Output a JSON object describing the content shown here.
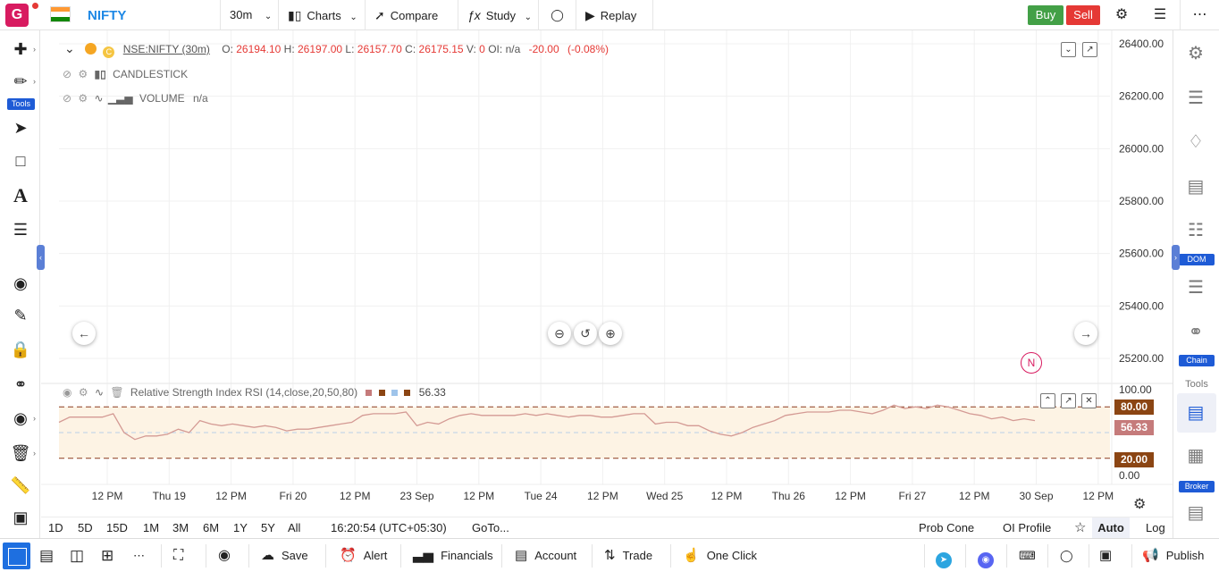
{
  "app": {
    "logo_letter": "G",
    "symbol": "NIFTY"
  },
  "toolbar": {
    "interval": "30m",
    "charts": "Charts",
    "compare": "Compare",
    "study": "Study",
    "replay": "Replay",
    "buy": "Buy",
    "sell": "Sell"
  },
  "left_toolbar": {
    "tools_badge": "Tools"
  },
  "legend": {
    "symbol_desc": "NSE:NIFTY (30m)",
    "o_label": "O:",
    "o": "26194.10",
    "h_label": "H:",
    "h": "26197.00",
    "l_label": "L:",
    "l": "26157.70",
    "c_label": "C:",
    "c": "26175.15",
    "v_label": "V:",
    "v": "0",
    "oi_label": "OI:",
    "oi": "n/a",
    "change": "-20.00",
    "change_pct": "(-0.08%)",
    "candlestick": "CANDLESTICK",
    "volume": "VOLUME",
    "volume_val": "n/a"
  },
  "rsi": {
    "title": "Relative Strength Index RSI (14,close,20,50,80)",
    "value": "56.33",
    "upper_tag": "80.00",
    "lower_tag": "20.00"
  },
  "n_badge": "N",
  "colors": {
    "rsi_line": "#d49a94",
    "rsi_band": "#fdf3e4",
    "rsi_dash": "#8b3a1f",
    "tag_brown": "#8b4513",
    "tag_rose": "#c57b7b",
    "accent_blue": "#1e5bd6"
  },
  "chart_data": {
    "type": "line",
    "price_axis": {
      "ticks": [
        "26400.00",
        "26200.00",
        "26000.00",
        "25800.00",
        "25600.00",
        "25400.00",
        "25200.00"
      ],
      "values": [
        26400,
        26200,
        26000,
        25800,
        25600,
        25400,
        25200
      ]
    },
    "rsi_axis": {
      "ticks": [
        "100.00",
        "0.00"
      ],
      "values": [
        100,
        0
      ],
      "upper": 80,
      "lower": 20,
      "ylim": [
        0,
        100
      ]
    },
    "time_axis": [
      "12 PM",
      "Thu 19",
      "12 PM",
      "Fri 20",
      "12 PM",
      "23 Sep",
      "12 PM",
      "Tue 24",
      "12 PM",
      "Wed 25",
      "12 PM",
      "Thu 26",
      "12 PM",
      "Fri 27",
      "12 PM",
      "30 Sep",
      "12 PM"
    ],
    "rsi_series": {
      "name": "RSI",
      "values": [
        62,
        68,
        68,
        68,
        68,
        72,
        50,
        42,
        46,
        46,
        48,
        54,
        50,
        64,
        60,
        58,
        60,
        58,
        56,
        58,
        56,
        52,
        54,
        54,
        56,
        58,
        60,
        62,
        70,
        72,
        72,
        72,
        74,
        58,
        62,
        60,
        66,
        70,
        72,
        70,
        70,
        70,
        70,
        72,
        70,
        72,
        70,
        68,
        70,
        70,
        68,
        68,
        70,
        72,
        72,
        60,
        62,
        62,
        58,
        58,
        52,
        48,
        46,
        50,
        56,
        60,
        64,
        70,
        72,
        74,
        74,
        74,
        76,
        76,
        74,
        72,
        76,
        82,
        78,
        80,
        78,
        82,
        80,
        76,
        72,
        70,
        66,
        68,
        64,
        66,
        64
      ]
    }
  },
  "range_bar": {
    "ranges": [
      "1D",
      "5D",
      "15D",
      "1M",
      "3M",
      "6M",
      "1Y",
      "5Y",
      "All"
    ],
    "clock": "16:20:54 (UTC+05:30)",
    "goto": "GoTo...",
    "prob_cone": "Prob Cone",
    "oi_profile": "OI Profile",
    "auto": "Auto",
    "log": "Log"
  },
  "right_toolbar": {
    "dom_badge": "DOM",
    "chain_badge": "Chain",
    "tools_label": "Tools",
    "broker_badge": "Broker"
  },
  "bottom_bar": {
    "save": "Save",
    "alert": "Alert",
    "financials": "Financials",
    "account": "Account",
    "trade": "Trade",
    "one_click": "One Click",
    "publish": "Publish"
  }
}
